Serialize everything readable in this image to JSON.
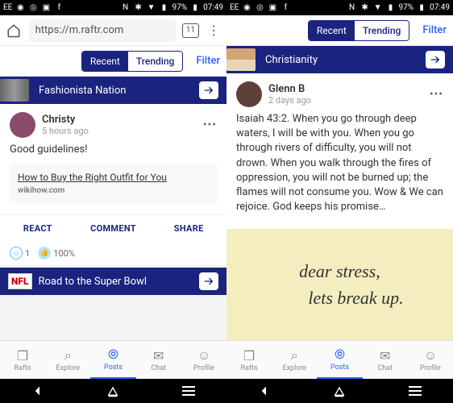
{
  "status": {
    "carrier": "EE",
    "battery": "97%",
    "time": "07:49"
  },
  "url": "https://m.raftr.com",
  "tab_count": "11",
  "tabs": {
    "recent": "Recent",
    "trending": "Trending",
    "filter": "Filter"
  },
  "left": {
    "group1": "Fashionista Nation",
    "post1": {
      "user": "Christy",
      "time": "5 hours ago",
      "body": "Good guidelines!"
    },
    "link": {
      "title": "How to Buy the Right Outfit for You",
      "src": "wikihow.com"
    },
    "actions": {
      "react": "REACT",
      "comment": "COMMENT",
      "share": "SHARE"
    },
    "reactions": {
      "count": "1",
      "percent": "100%"
    },
    "group2": "Road to the Super Bowl",
    "nfl": "NFL"
  },
  "right": {
    "group": "Christianity",
    "post": {
      "user": "Glenn B",
      "time": "2 days ago",
      "body": "Isaiah 43:2. When you go through deep waters, I will be with you. When you go through rivers of difficulty, you will not drown. When you walk through the fires of oppression, you will not be burned up; the flames will not consume you. Wow & We can rejoice. God keeps his promise…"
    },
    "note": {
      "line1": "dear stress,",
      "line2": "lets break up."
    }
  },
  "nav": {
    "rafts": "Rafts",
    "explore": "Explore",
    "posts": "Posts",
    "chat": "Chat",
    "profile": "Profile"
  }
}
